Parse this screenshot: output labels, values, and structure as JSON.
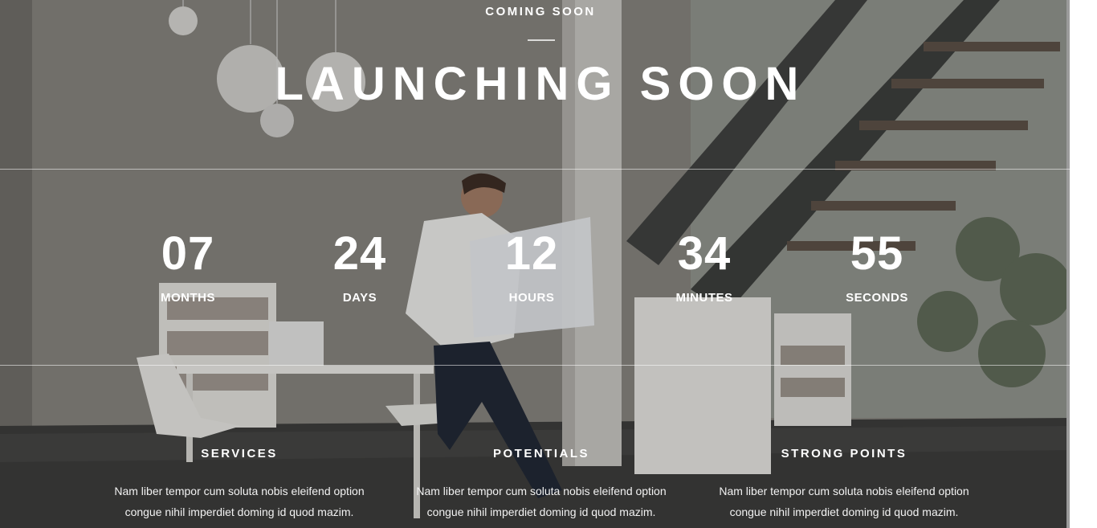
{
  "header": {
    "eyebrow": "COMING SOON",
    "title": "LAUNCHING SOON"
  },
  "countdown": [
    {
      "value": "07",
      "label": "MONTHS"
    },
    {
      "value": "24",
      "label": "DAYS"
    },
    {
      "value": "12",
      "label": "HOURS"
    },
    {
      "value": "34",
      "label": "MINUTES"
    },
    {
      "value": "55",
      "label": "SECONDS"
    }
  ],
  "features": [
    {
      "title": "SERVICES",
      "text_line1": "Nam liber tempor cum soluta nobis eleifend option",
      "text_line2": "congue nihil imperdiet doming id quod mazim."
    },
    {
      "title": "POTENTIALS",
      "text_line1": "Nam liber tempor cum soluta nobis eleifend option",
      "text_line2": "congue nihil imperdiet doming id quod mazim."
    },
    {
      "title": "STRONG POINTS",
      "text_line1": "Nam liber tempor cum soluta nobis eleifend option",
      "text_line2": "congue nihil imperdiet doming id quod mazim."
    }
  ],
  "colors": {
    "text": "#ffffff",
    "divider": "#d9d9d9",
    "background_tone": "#7d7a73"
  }
}
